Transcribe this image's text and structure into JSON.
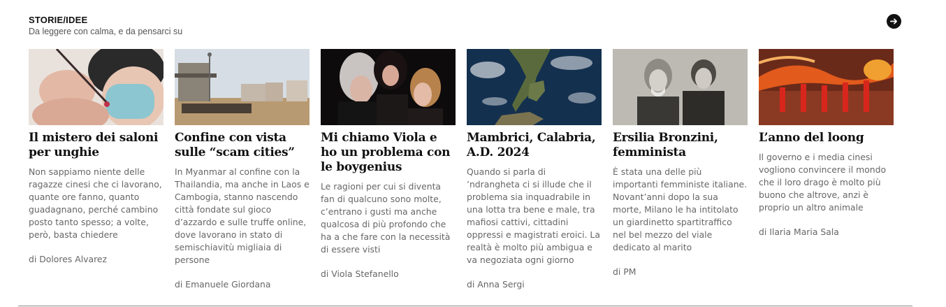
{
  "section": {
    "title": "STORIE/IDEE",
    "subtitle": "Da leggere con calma, e da pensarci su",
    "arrow_icon": "arrow-right-icon"
  },
  "cards": [
    {
      "title": "Il mistero dei saloni per unghie",
      "description": "Non sappiamo niente delle ragazze cinesi che ci lavorano, quante ore fanno, quanto guadagnano, perché cambino posto tanto spesso; a volte, però, basta chiedere",
      "author": "di Dolores Alvarez"
    },
    {
      "title": "Confine con vista sulle “scam cities”",
      "description": "In Myanmar al confine con la Thailandia, ma anche in Laos e Cambogia, stanno nascendo città fondate sul gioco d’azzardo e sulle truffe online, dove lavorano in stato di semischiavitù migliaia di persone",
      "author": "di Emanuele Giordana"
    },
    {
      "title": "Mi chiamo Viola e ho un problema con le boygenius",
      "description": "Le ragioni per cui si diventa fan di qualcuno sono molte, c’entrano i gusti ma anche qualcosa di più profondo che ha a che fare con la necessità di essere visti",
      "author": "di Viola Stefanello"
    },
    {
      "title": "Mambrici, Calabria, A.D. 2024",
      "description": "Quando si parla di ’ndrangheta ci si illude che il problema sia inquadrabile in una lotta tra bene e male, tra mafiosi cattivi, cittadini oppressi e magistrati eroici. La realtà è molto più ambigua e va negoziata ogni giorno",
      "author": "di Anna Sergi"
    },
    {
      "title": "Ersilia Bronzini, femminista",
      "description": "È stata una delle più importanti femministe italiane. Novant’anni dopo la sua morte, Milano le ha intitolato un giardinetto spartitraffico nel bel mezzo del viale dedicato al marito",
      "author": "di PM"
    },
    {
      "title": "L’anno del loong",
      "description": "Il governo e i media cinesi vogliono convincere il mondo che il loro drago è molto più buono che altrove, anzi è proprio un altro animale",
      "author": "di Ilaria Maria Sala"
    }
  ]
}
